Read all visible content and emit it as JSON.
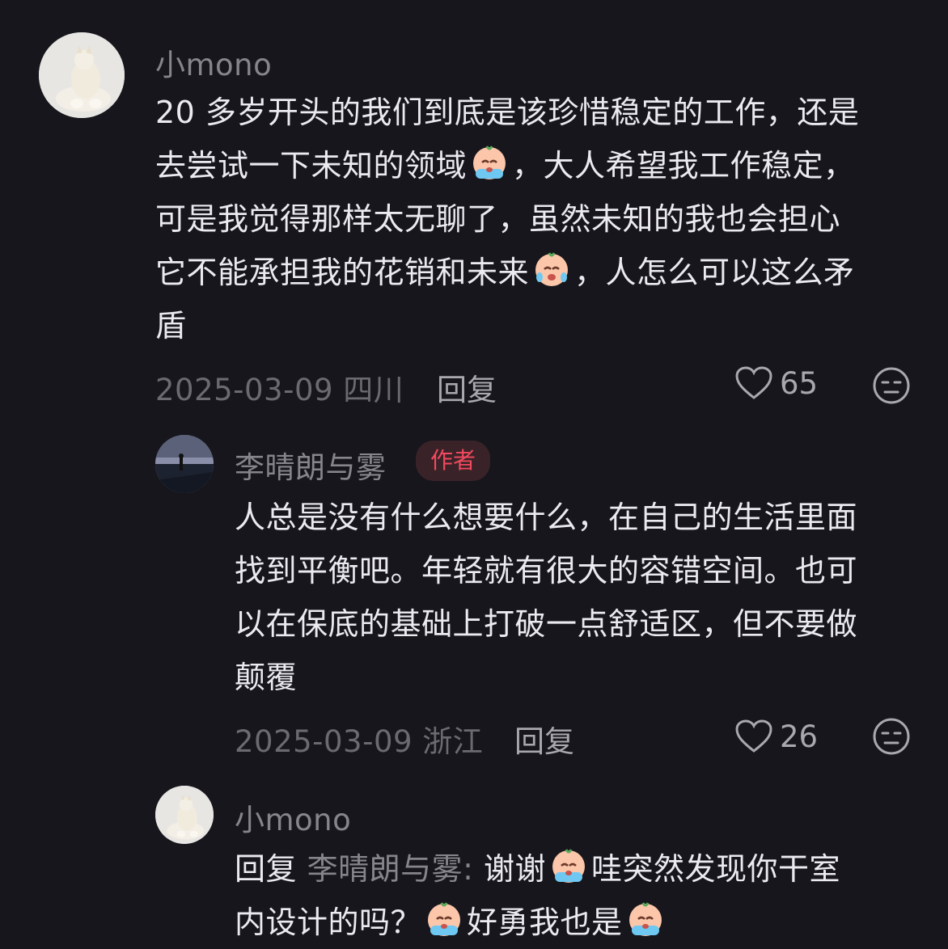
{
  "comments": [
    {
      "username": "小mono",
      "lines": [
        "20 多岁开头的我们到底是该珍惜稳定的工作，还是",
        "去尝试一下未知的领域",
        "，大人希望我工作稳定，",
        "可是我觉得那样太无聊了，虽然未知的我也会担心",
        "它不能承担我的花销和未来",
        "，人怎么可以这么矛",
        "盾"
      ],
      "date_location": "2025-03-09 四川",
      "reply_label": "回复",
      "likes": "65"
    },
    {
      "username": "李晴朗与雾",
      "badge": "作者",
      "lines": [
        "人总是没有什么想要什么，在自己的生活里面",
        "找到平衡吧。年轻就有很大的容错空间。也可",
        "以在保底的基础上打破一点舒适区，但不要做",
        "颠覆"
      ],
      "date_location": "2025-03-09 浙江",
      "reply_label": "回复",
      "likes": "26"
    },
    {
      "username": "小mono",
      "reply_prefix": "回复",
      "reply_target": "李晴朗与雾:",
      "line1_a": "谢谢",
      "line1_b": "哇突然发现你干室",
      "line2_a": "内设计的吗？",
      "line2_b": "好勇我也是"
    }
  ],
  "icons": {
    "like": "heart-icon",
    "dislike": "dislike-face-icon",
    "emoji": "crying-emoji"
  }
}
